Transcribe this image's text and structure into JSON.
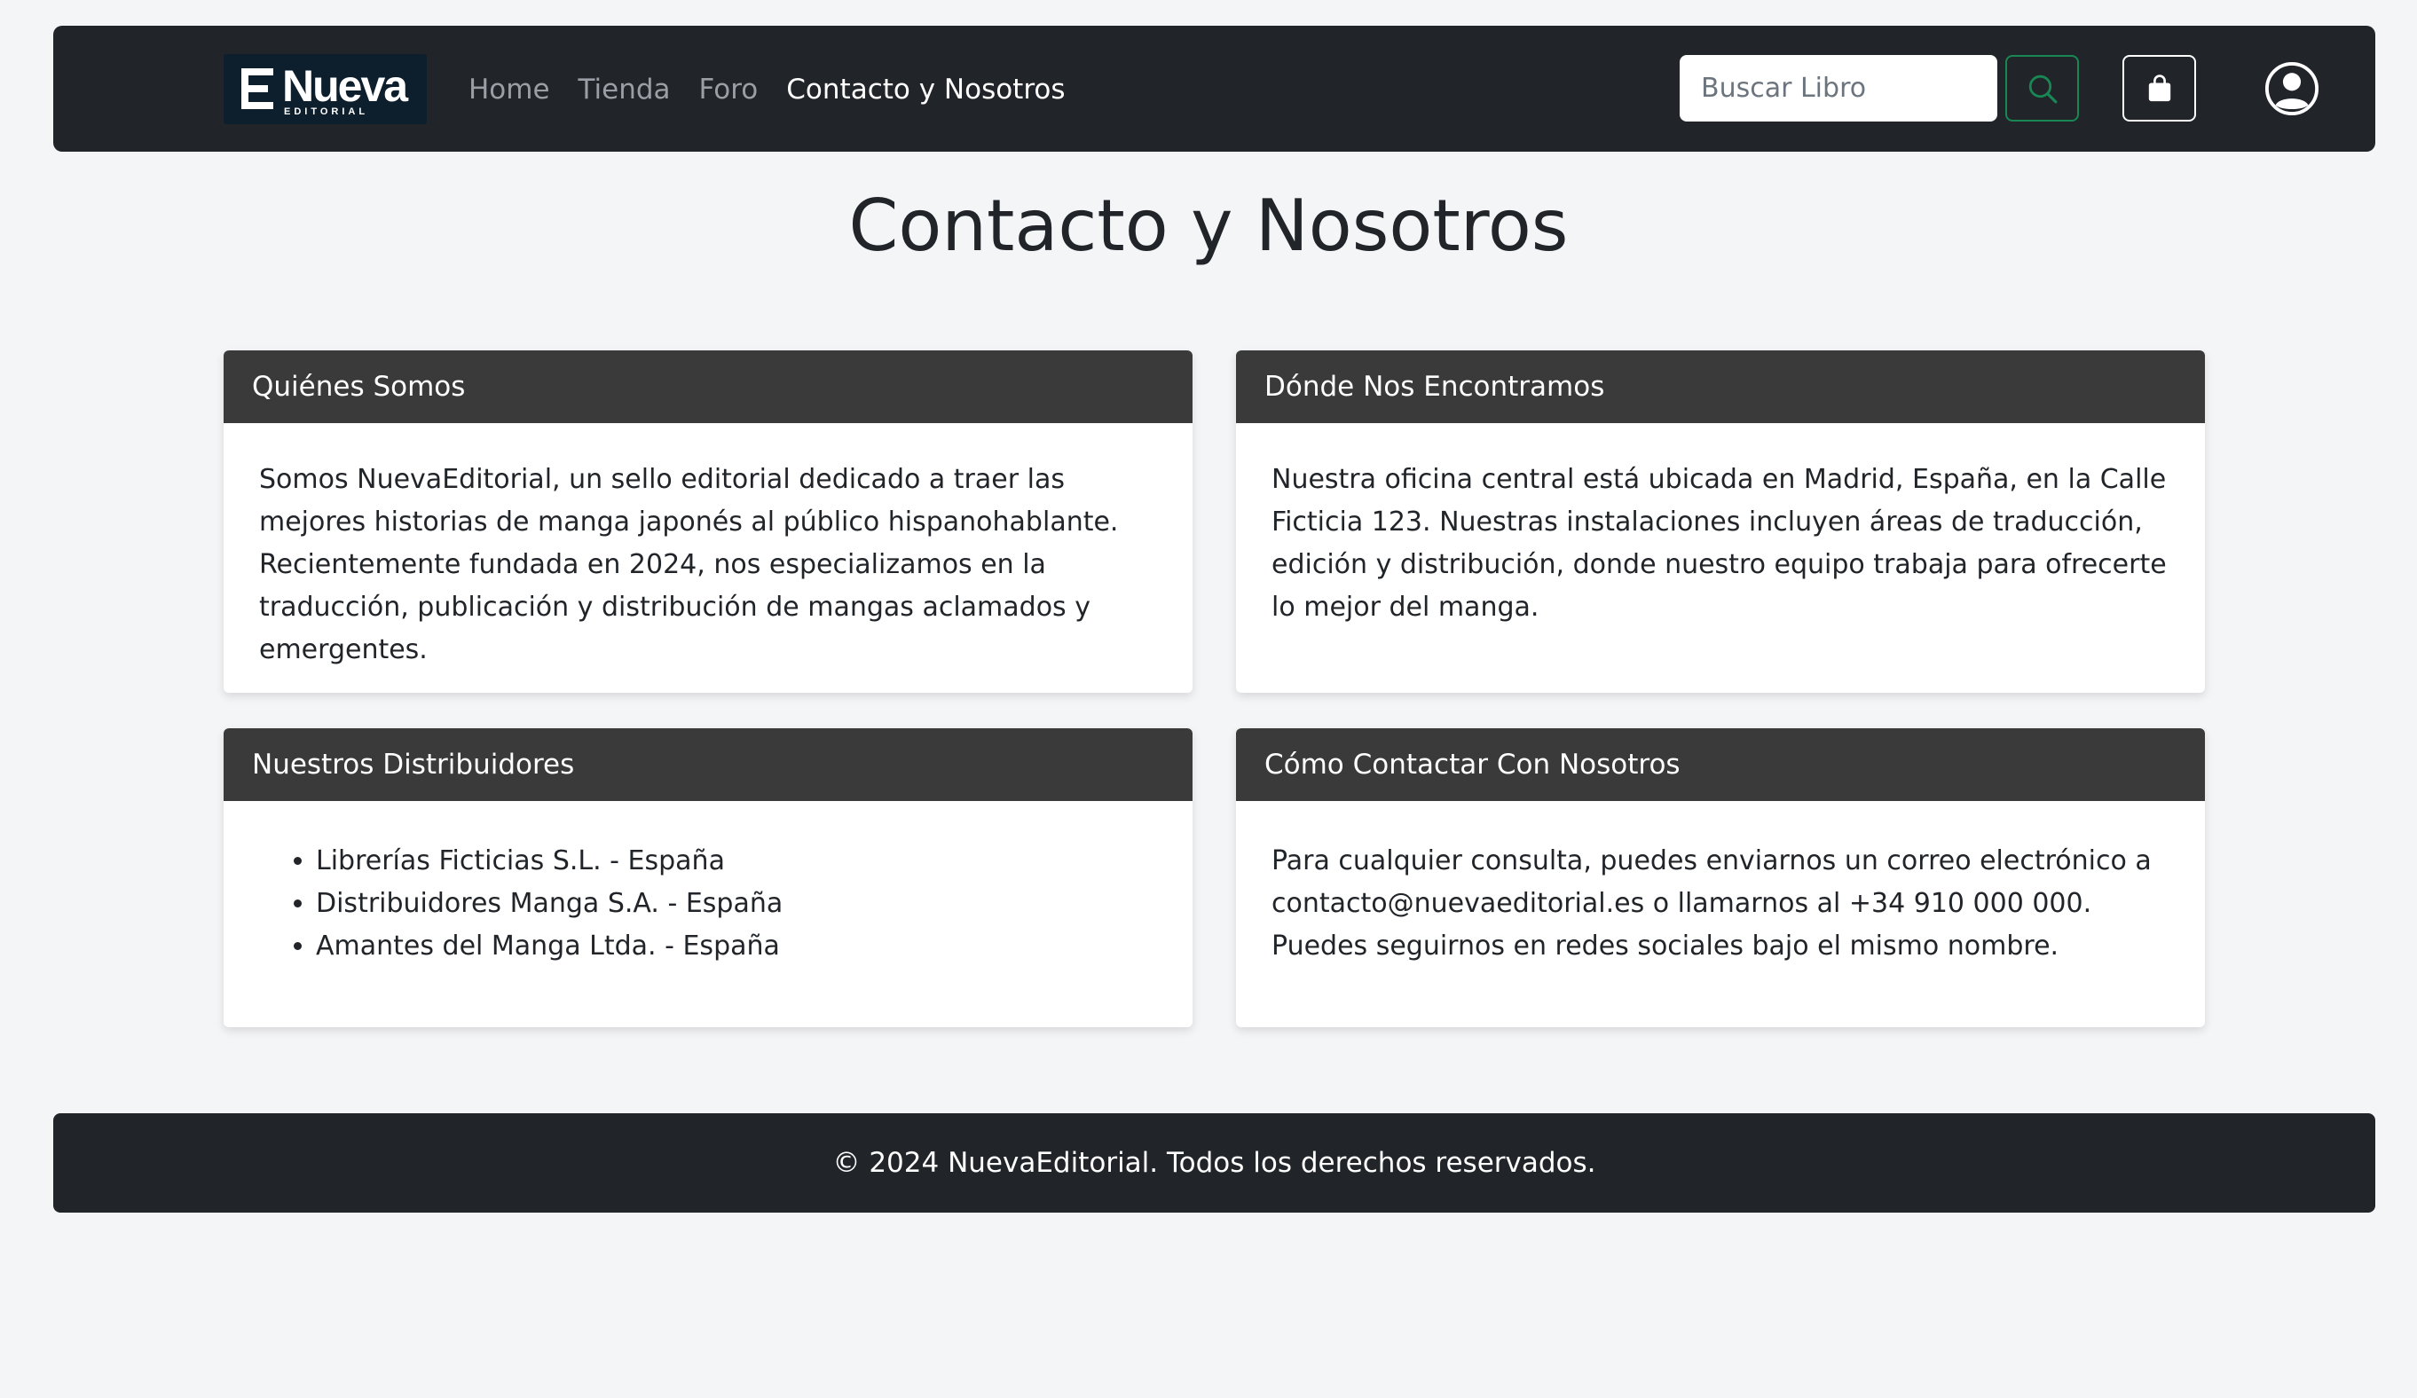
{
  "brand": {
    "logo_word": "Nueva",
    "logo_sub": "EDITORIAL"
  },
  "nav": {
    "links": [
      {
        "label": "Home",
        "active": false
      },
      {
        "label": "Tienda",
        "active": false
      },
      {
        "label": "Foro",
        "active": false
      },
      {
        "label": "Contacto y Nosotros",
        "active": true
      }
    ],
    "search_placeholder": "Buscar Libro",
    "search_icon": "search-icon",
    "cart_icon": "shopping-bag-icon",
    "user_icon": "user-circle-icon"
  },
  "page": {
    "title": "Contacto y Nosotros"
  },
  "cards": {
    "about": {
      "title": "Quiénes Somos",
      "text": "Somos NuevaEditorial, un sello editorial dedicado a traer las mejores historias de manga japonés al público hispanohablante. Recientemente fundada en 2024, nos especializamos en la traducción, publicación y distribución de mangas aclamados y emergentes."
    },
    "location": {
      "title": "Dónde Nos Encontramos",
      "text": "Nuestra oficina central está ubicada en Madrid, España, en la Calle Ficticia 123. Nuestras instalaciones incluyen áreas de traducción, edición y distribución, donde nuestro equipo trabaja para ofrecerte lo mejor del manga."
    },
    "distributors": {
      "title": "Nuestros Distribuidores",
      "items": [
        "Librerías Ficticias S.L. - España",
        "Distribuidores Manga S.A. - España",
        "Amantes del Manga Ltda. - España"
      ]
    },
    "contact": {
      "title": "Cómo Contactar Con Nosotros",
      "text": "Para cualquier consulta, puedes enviarnos un correo electrónico a contacto@nuevaeditorial.es o llamarnos al +34 910 000 000. Puedes seguirnos en redes sociales bajo el mismo nombre."
    }
  },
  "footer": {
    "text": "© 2024 NuevaEditorial. Todos los derechos reservados."
  },
  "colors": {
    "navbar_bg": "#212429",
    "card_header_bg": "#3a3a3a",
    "page_bg": "#f4f5f7",
    "search_accent": "#198754"
  }
}
